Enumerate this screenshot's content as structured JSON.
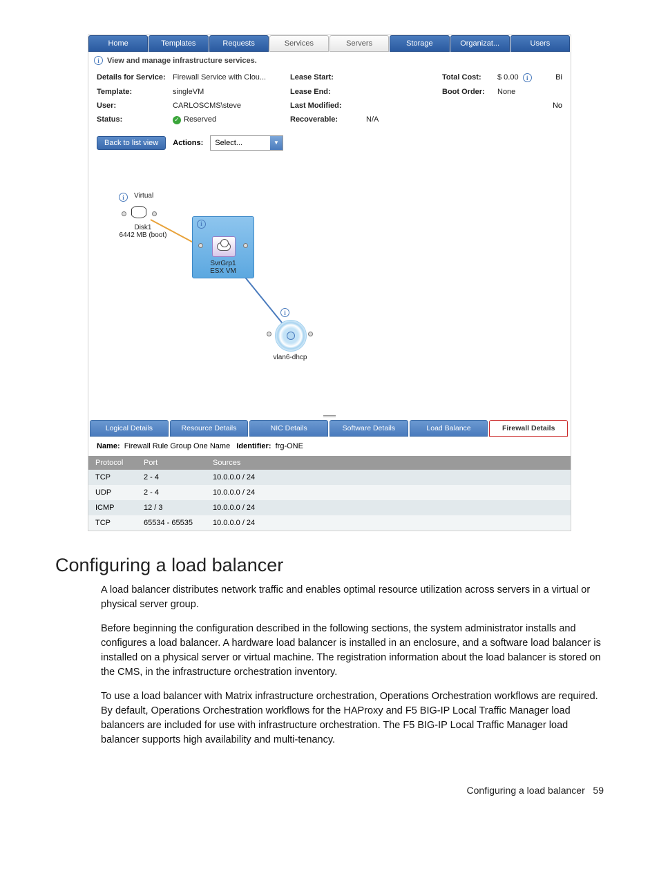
{
  "topnav": {
    "blue": [
      "Home",
      "Templates",
      "Requests"
    ],
    "light": [
      "Services",
      "Servers"
    ],
    "blue2": [
      "Storage",
      "Organizat...",
      "Users"
    ]
  },
  "subtitle": "View and manage infrastructure services.",
  "details": {
    "service_label": "Details for Service:",
    "service_value": "Firewall Service with Clou...",
    "template_label": "Template:",
    "template_value": "singleVM",
    "user_label": "User:",
    "user_value": "CARLOSCMS\\steve",
    "status_label": "Status:",
    "status_value": "Reserved",
    "lease_start_label": "Lease Start:",
    "lease_end_label": "Lease End:",
    "last_modified_label": "Last Modified:",
    "recoverable_label": "Recoverable:",
    "recoverable_value": "N/A",
    "total_cost_label": "Total Cost:",
    "total_cost_value": "$ 0.00",
    "boot_order_label": "Boot Order:",
    "boot_order_value": "None",
    "bi": "Bi",
    "no": "No"
  },
  "actions": {
    "back": "Back to list view",
    "actions_label": "Actions:",
    "select_placeholder": "Select..."
  },
  "diagram": {
    "virtual": "Virtual",
    "disk_name": "Disk1",
    "disk_size": "6442 MB (boot)",
    "svr_name": "SvrGrp1",
    "svr_type": "ESX VM",
    "vlan": "vlan6-dhcp"
  },
  "tabs2": [
    "Logical Details",
    "Resource Details",
    "NIC Details",
    "Software Details",
    "Load Balance",
    "Firewall Details"
  ],
  "fw": {
    "name_label": "Name:",
    "name_value": "Firewall Rule Group One Name",
    "id_label": "Identifier:",
    "id_value": "frg-ONE",
    "headers": [
      "Protocol",
      "Port",
      "Sources"
    ],
    "rows": [
      [
        "TCP",
        "2 - 4",
        "10.0.0.0 / 24"
      ],
      [
        "UDP",
        "2 - 4",
        "10.0.0.0 / 24"
      ],
      [
        "ICMP",
        "12 / 3",
        "10.0.0.0 / 24"
      ],
      [
        "TCP",
        "65534 - 65535",
        "10.0.0.0 / 24"
      ]
    ]
  },
  "doc": {
    "heading": "Configuring a load balancer",
    "p1": "A load balancer distributes network traffic and enables optimal resource utilization across servers in a virtual or physical server group.",
    "p2": "Before beginning the configuration described in the following sections, the system administrator installs and configures a load balancer. A hardware load balancer is installed in an enclosure, and a software load balancer is installed on a physical server or virtual machine. The registration information about the load balancer is stored on the CMS, in the infrastructure orchestration inventory.",
    "p3": "To use a load balancer with Matrix infrastructure orchestration, Operations Orchestration workflows are required. By default, Operations Orchestration workflows for the HAProxy and F5 BIG-IP Local Traffic Manager load balancers are included for use with infrastructure orchestration. The F5 BIG-IP Local Traffic Manager load balancer supports high availability and multi-tenancy."
  },
  "footer": {
    "text": "Configuring a load balancer",
    "page": "59"
  }
}
